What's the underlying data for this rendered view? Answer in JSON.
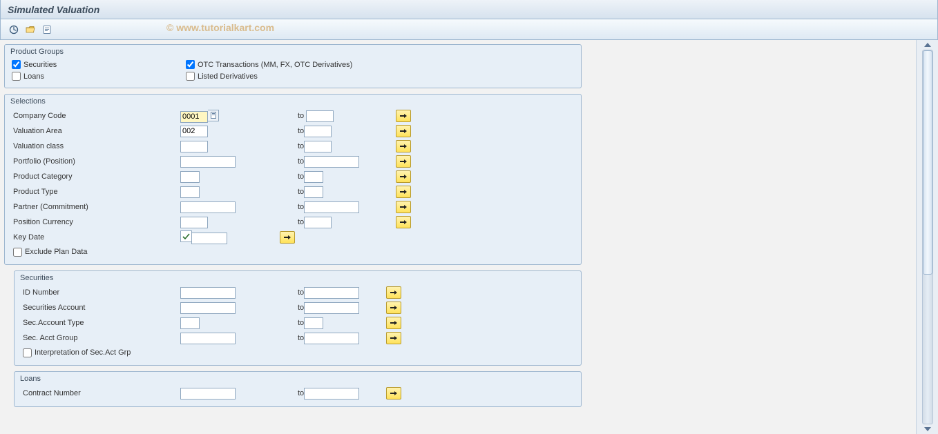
{
  "title": "Simulated Valuation",
  "watermark": "© www.tutorialkart.com",
  "toolbar": {
    "execute": "Execute",
    "variant_get": "Get Variant",
    "variant_save": "Save Variant (Program Docu.)"
  },
  "groups": {
    "productGroups": {
      "title": "Product Groups",
      "securities": "Securities",
      "otc": "OTC Transactions (MM, FX, OTC Derivatives)",
      "loans": "Loans",
      "listed": "Listed Derivatives",
      "securities_checked": true,
      "otc_checked": true,
      "loans_checked": false,
      "listed_checked": false
    },
    "selections": {
      "title": "Selections",
      "to": "to",
      "companyCode": {
        "label": "Company Code",
        "from": "0001",
        "to": ""
      },
      "valuationArea": {
        "label": "Valuation Area",
        "from": "002",
        "to": ""
      },
      "valuationClass": {
        "label": "Valuation class",
        "from": "",
        "to": ""
      },
      "portfolio": {
        "label": "Portfolio (Position)",
        "from": "",
        "to": ""
      },
      "productCategory": {
        "label": "Product Category",
        "from": "",
        "to": ""
      },
      "productType": {
        "label": "Product Type",
        "from": "",
        "to": ""
      },
      "partner": {
        "label": "Partner (Commitment)",
        "from": "",
        "to": ""
      },
      "positionCurrency": {
        "label": "Position Currency",
        "from": "",
        "to": ""
      },
      "keyDate": {
        "label": "Key Date",
        "from": ""
      },
      "excludePlan": "Exclude Plan Data",
      "excludePlan_checked": false
    },
    "securities": {
      "title": "Securities",
      "to": "to",
      "idNumber": {
        "label": "ID Number",
        "from": "",
        "to": ""
      },
      "secAccount": {
        "label": "Securities Account",
        "from": "",
        "to": ""
      },
      "secAcctType": {
        "label": "Sec.Account Type",
        "from": "",
        "to": ""
      },
      "secAcctGroup": {
        "label": "Sec. Acct Group",
        "from": "",
        "to": ""
      },
      "interpret": "Interpretation of Sec.Act Grp",
      "interpret_checked": false
    },
    "loans": {
      "title": "Loans",
      "to": "to",
      "contractNumber": {
        "label": "Contract Number",
        "from": "",
        "to": ""
      }
    }
  }
}
